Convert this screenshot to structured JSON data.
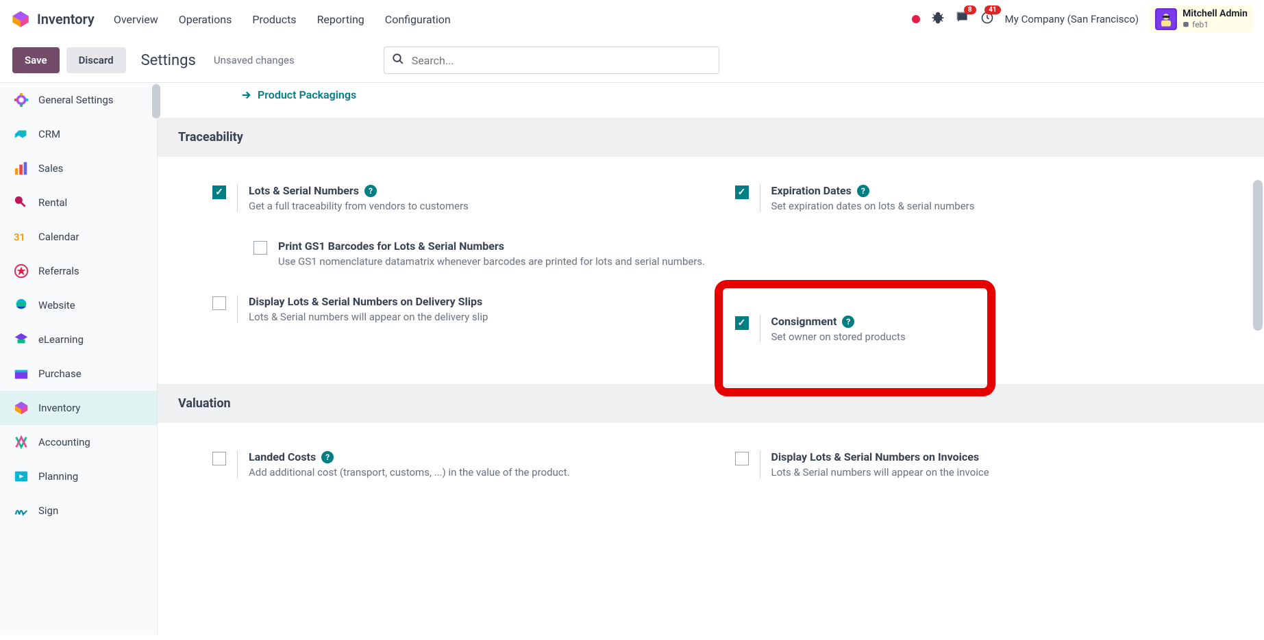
{
  "app": {
    "title": "Inventory"
  },
  "nav": {
    "items": [
      "Overview",
      "Operations",
      "Products",
      "Reporting",
      "Configuration"
    ]
  },
  "header": {
    "messages_badge": "8",
    "activities_badge": "41",
    "company": "My Company (San Francisco)",
    "user_name": "Mitchell Admin",
    "db_name": "feb1"
  },
  "actionbar": {
    "save": "Save",
    "discard": "Discard",
    "title": "Settings",
    "status": "Unsaved changes",
    "search_placeholder": "Search..."
  },
  "sidebar": {
    "items": [
      {
        "label": "General Settings"
      },
      {
        "label": "CRM"
      },
      {
        "label": "Sales"
      },
      {
        "label": "Rental"
      },
      {
        "label": "Calendar"
      },
      {
        "label": "Referrals"
      },
      {
        "label": "Website"
      },
      {
        "label": "eLearning"
      },
      {
        "label": "Purchase"
      },
      {
        "label": "Inventory"
      },
      {
        "label": "Accounting"
      },
      {
        "label": "Planning"
      },
      {
        "label": "Sign"
      }
    ]
  },
  "content": {
    "link_packagings": "Product Packagings",
    "section_traceability": "Traceability",
    "section_valuation": "Valuation",
    "settings": {
      "lots": {
        "title": "Lots & Serial Numbers",
        "desc": "Get a full traceability from vendors to customers"
      },
      "expiration": {
        "title": "Expiration Dates",
        "desc": "Set expiration dates on lots & serial numbers"
      },
      "gs1": {
        "title": "Print GS1 Barcodes for Lots & Serial Numbers",
        "desc": "Use GS1 nomenclature datamatrix whenever barcodes are printed for lots and serial numbers."
      },
      "delivery": {
        "title": "Display Lots & Serial Numbers on Delivery Slips",
        "desc": "Lots & Serial numbers will appear on the delivery slip"
      },
      "consignment": {
        "title": "Consignment",
        "desc": "Set owner on stored products"
      },
      "landed": {
        "title": "Landed Costs",
        "desc": "Add additional cost (transport, customs, ...) in the value of the product."
      },
      "invoices": {
        "title": "Display Lots & Serial Numbers on Invoices",
        "desc": "Lots & Serial numbers will appear on the invoice"
      }
    }
  }
}
